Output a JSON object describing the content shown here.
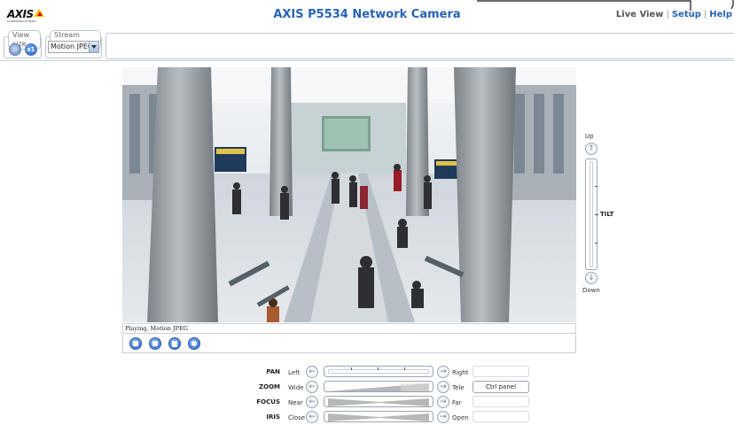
{
  "header": {
    "logo_text": "AXIS",
    "logo_subtext": "COMMUNICATIONS",
    "title": "AXIS P5534 Network Camera",
    "nav": [
      {
        "label": "Live View"
      },
      {
        "label": "Setup"
      },
      {
        "label": "Help"
      }
    ]
  },
  "toolbar": {
    "view_size_label": "View size",
    "stream_profile_label": "Stream profile",
    "stream_profile_value": "Motion JPEG",
    "view_size_buttons": [
      {
        "icon": "half-size-icon"
      },
      {
        "icon": "full-size-icon",
        "text": "x1"
      }
    ]
  },
  "video": {
    "status": "Playing, Motion JPEG",
    "controls": [
      {
        "icon": "stop-icon"
      },
      {
        "icon": "snapshot-icon"
      },
      {
        "icon": "record-icon"
      },
      {
        "icon": "pan-tilt-icon"
      }
    ]
  },
  "tilt": {
    "up_label": "Up",
    "down_label": "Down",
    "label": "TILT"
  },
  "ptz": {
    "rows": [
      {
        "name": "PAN",
        "left": "Left",
        "right": "Right"
      },
      {
        "name": "ZOOM",
        "left": "Wide",
        "right": "Tele"
      },
      {
        "name": "FOCUS",
        "left": "Near",
        "right": "Far"
      },
      {
        "name": "IRIS",
        "left": "Close",
        "right": "Open"
      }
    ],
    "ctrl_panel_label": "Ctrl panel"
  },
  "colors": {
    "brand_blue": "#2663b8",
    "panel_border": "#bfc6cf"
  }
}
